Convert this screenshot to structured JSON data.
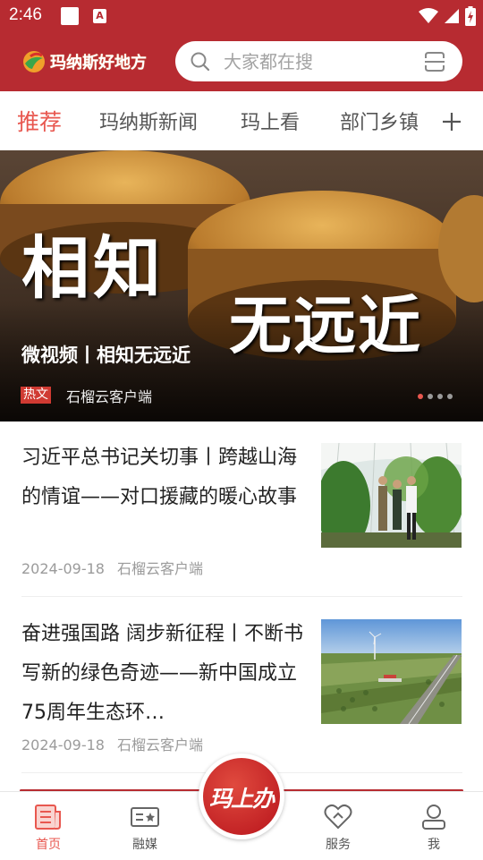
{
  "status_bar": {
    "time": "2:46"
  },
  "header": {
    "logo_text": "玛纳斯好地方",
    "search_placeholder": "大家都在搜"
  },
  "tabs": [
    {
      "label": "推荐",
      "active": true
    },
    {
      "label": "玛纳斯新闻",
      "active": false
    },
    {
      "label": "玛上看",
      "active": false
    },
    {
      "label": "部门乡镇",
      "active": false
    }
  ],
  "banner": {
    "overlay_line1": "相知",
    "overlay_line2": "无远近",
    "title": "微视频丨相知无远近",
    "tag": "热文",
    "source": "石榴云客户端",
    "slide_count": 4,
    "current_slide": 1
  },
  "news": [
    {
      "title": "习近平总书记关切事丨跨越山海的情谊——对口援藏的暖心故事",
      "date": "2024-09-18",
      "source": "石榴云客户端"
    },
    {
      "title": "奋进强国路 阔步新征程丨不断书写新的绿色奇迹——新中国成立75周年生态环…",
      "date": "2024-09-18",
      "source": "石榴云客户端"
    }
  ],
  "bottom_nav": {
    "items": [
      {
        "label": "首页",
        "icon": "home-news-icon",
        "active": true
      },
      {
        "label": "融媒",
        "icon": "media-card-icon",
        "active": false
      },
      {
        "label": "服务",
        "icon": "service-heart-icon",
        "active": false
      },
      {
        "label": "我",
        "icon": "user-icon",
        "active": false
      }
    ],
    "center_label": "玛上办"
  },
  "colors": {
    "brand_red": "#b72b31",
    "accent": "#e8574f"
  }
}
